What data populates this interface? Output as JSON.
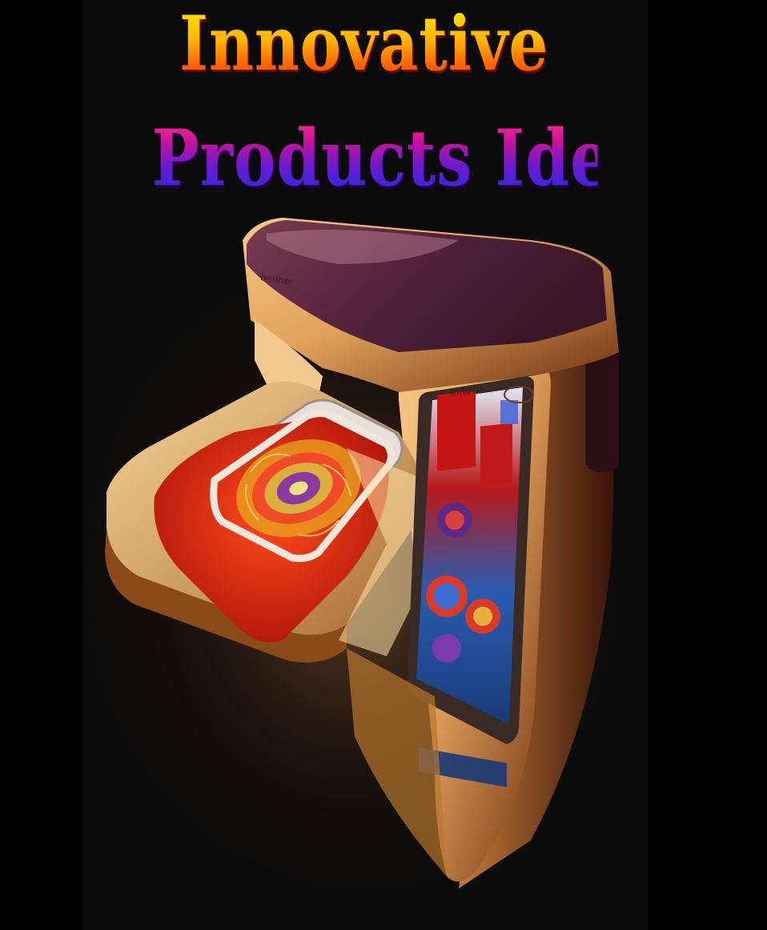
{
  "poster": {
    "title_line_1": "Innovative",
    "title_line_2": "Products Ideas",
    "image": {
      "subject": "embroidery-sewing-machine",
      "brand_label": "brother",
      "model_label": "innovis"
    },
    "colors": {
      "background": "#000000",
      "poster_background": "#0b0b0b",
      "title_1_top": "#ffe800",
      "title_1_bottom": "#ff3a10",
      "title_2_top": "#ff2a8a",
      "title_2_bottom": "#2a2ae0",
      "machine_body": "#e0a560",
      "machine_top": "#5a2a3c",
      "fabric": "#d21e0e",
      "screen": "#2a6cc0"
    }
  }
}
